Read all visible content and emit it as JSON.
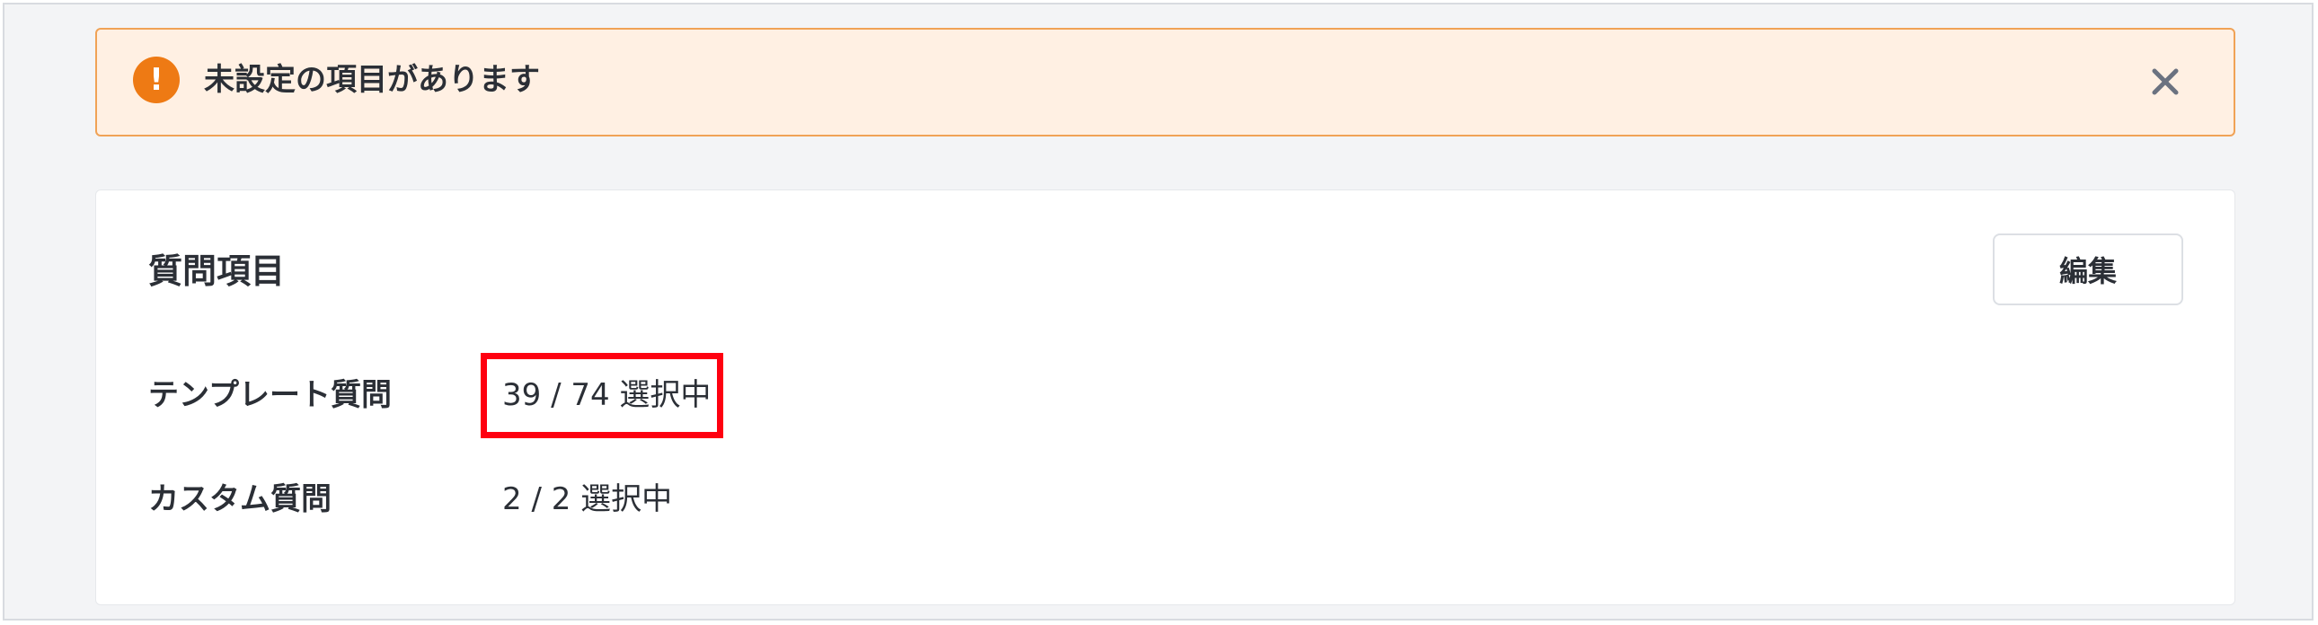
{
  "alert": {
    "icon": "exclamation-icon",
    "icon_glyph": "!",
    "message": "未設定の項目があります",
    "close_icon": "close-icon",
    "accent_color": "#ee7a14"
  },
  "card": {
    "title": "質問項目",
    "edit_label": "編集",
    "rows": [
      {
        "label": "テンプレート質問",
        "value": "39 / 74 選択中"
      },
      {
        "label": "カスタム質問",
        "value": "2 / 2 選択中"
      }
    ]
  },
  "annotation": {
    "highlight_color": "#ff0010"
  }
}
